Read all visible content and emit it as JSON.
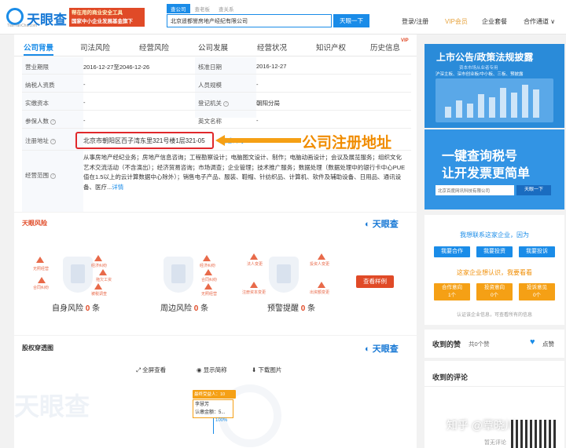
{
  "header": {
    "logo_text": "天眼查",
    "logo_sub": "TianYanCha.com",
    "banner_line1": "帮在用的商业安全工具",
    "banner_line2": "国家中小企业发展基金旗下",
    "search_tabs": [
      "查公司",
      "查老板",
      "查关系"
    ],
    "search_value": "北京遥都誉房地产经纪有限公司",
    "search_button": "天眼一下",
    "nav": [
      "登录/注册",
      "VIP会员",
      "企业套餐",
      "合作通道 ∨"
    ]
  },
  "tabs": [
    "公司背景",
    "司法风险",
    "经营风险",
    "公司发展",
    "经营状况",
    "知识产权",
    "历史信息"
  ],
  "vip_badge": "VIP",
  "info_rows": [
    {
      "l1": "营业期限",
      "v1": "2016-12-27至2046-12-26",
      "l2": "核准日期",
      "v2": "2016-12-27"
    },
    {
      "l1": "纳税人资质",
      "v1": "-",
      "l2": "人员规模",
      "v2": "-"
    },
    {
      "l1": "实缴资本",
      "v1": "-",
      "l2": "登记机关",
      "v2": "朝阳分局"
    },
    {
      "l1": "参保人数",
      "v1": "-",
      "l2": "英文名称",
      "v2": "-"
    }
  ],
  "address_label": "注册地址",
  "address_value": "北京市朝阳区百子湾东里321号楼1层321-05",
  "address_link": "附近公司",
  "scope_label": "经营范围",
  "scope_text": "从事房地产经纪业务；房地产信息咨询；工程勘察设计；电脑图文设计、制作；电脑动画设计；会议及展览服务；组织文化艺术交流活动（不含演出）；经济贸易咨询；市场调查；企业管理；技术推广服务；数据处理（数据处理中的银行卡中心PUE值在1.5以上的云计算数据中心除外）；销售电子产品、服装、鞋帽、针纺织品、计算机、软件及辅助设备、日用品、通讯设备、医疗...",
  "scope_more": "详情",
  "callout": "公司注册地址",
  "risk": {
    "title": "天眼风险",
    "brand": "天眼查",
    "groups": [
      {
        "name": "自身风险",
        "count": "0",
        "unit": "条",
        "labels": [
          "经济纠纷",
          "无照经营",
          "拖欠工资",
          "合同纠纷",
          "被税调查"
        ]
      },
      {
        "name": "周边风险",
        "count": "0",
        "unit": "条",
        "labels": [
          "经济纠纷",
          "合同纠纷",
          "无照经营"
        ]
      },
      {
        "name": "预警提醒",
        "count": "0",
        "unit": "条",
        "labels": [
          "法人变更",
          "投资人变更",
          "注册资本变更",
          "出资额变更"
        ]
      }
    ],
    "sample_button": "查看样例"
  },
  "equity": {
    "title": "股权穿透图",
    "brand": "天眼查",
    "tools": [
      "全屏查看",
      "显示简称",
      "下载图片"
    ],
    "node_head": "最终受益人：10",
    "node_name": "李慧芳",
    "node_amount": "认缴金额：5...",
    "percent": "100%",
    "watermark": "天眼查"
  },
  "sidebar": {
    "ad1_title": "上市公告/政策法规披露",
    "ad1_sub1": "资本市场从业者专用",
    "ad1_sub2": "沪深主板、深市创业板/中小板、三板、预披露",
    "ad2_line1": "一键查询税号",
    "ad2_line2": "让开发票更简单",
    "ad2_input": "北京百度网讯科技有限公司",
    "ad2_button": "天眼一下",
    "contact_title": "我想联系这家企业，因为",
    "contact_buttons": [
      "我要合作",
      "我要投资",
      "我要投诉"
    ],
    "interest_title": "这家企业想认识，我要看看",
    "interest_buttons": [
      {
        "label": "合作意向",
        "count": "1个"
      },
      {
        "label": "投资意向",
        "count": "0个"
      },
      {
        "label": "投诉意见",
        "count": "0个"
      }
    ],
    "contact_note": "认证该企业信息，可查看所有的信息",
    "likes_label": "收到的赞",
    "likes_count": "共0个赞",
    "like_button": "点赞",
    "comments_label": "收到的评论",
    "no_comment": "暂无评论",
    "watermark": "知乎 @覃晓川"
  }
}
